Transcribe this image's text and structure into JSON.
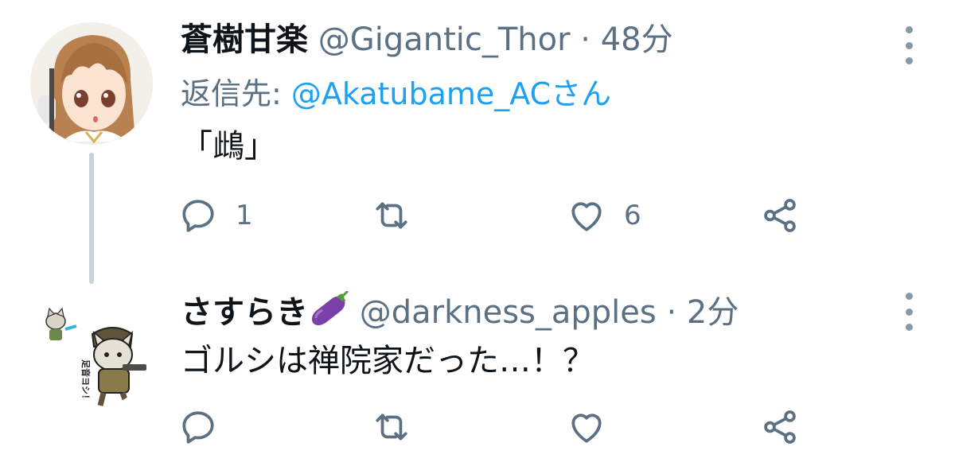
{
  "tweets": [
    {
      "display_name": "蒼樹甘楽",
      "handle": "@Gigantic_Thor",
      "separator": "·",
      "time": "48分",
      "reply_prefix": "返信先: ",
      "reply_to": "@Akatubame_ACさん",
      "text": "「䳄」",
      "actions": {
        "reply_count": "1",
        "retweet_count": "",
        "like_count": "6"
      },
      "avatar": "anime-girl-avatar"
    },
    {
      "display_name": "さすらき",
      "name_emoji": "eggplant-emoji",
      "handle": "@darkness_apples",
      "separator": "·",
      "time": "2分",
      "text": "ゴルシは禅院家だった…！？",
      "actions": {
        "reply_count": "",
        "retweet_count": "",
        "like_count": ""
      },
      "avatar": "cat-soldier-avatar",
      "avatar_caption": "足音ヨシ！"
    }
  ],
  "colors": {
    "text": "#0f1419",
    "secondary": "#5b7083",
    "link": "#1da1f2",
    "thread_line": "#c9d3dc"
  }
}
